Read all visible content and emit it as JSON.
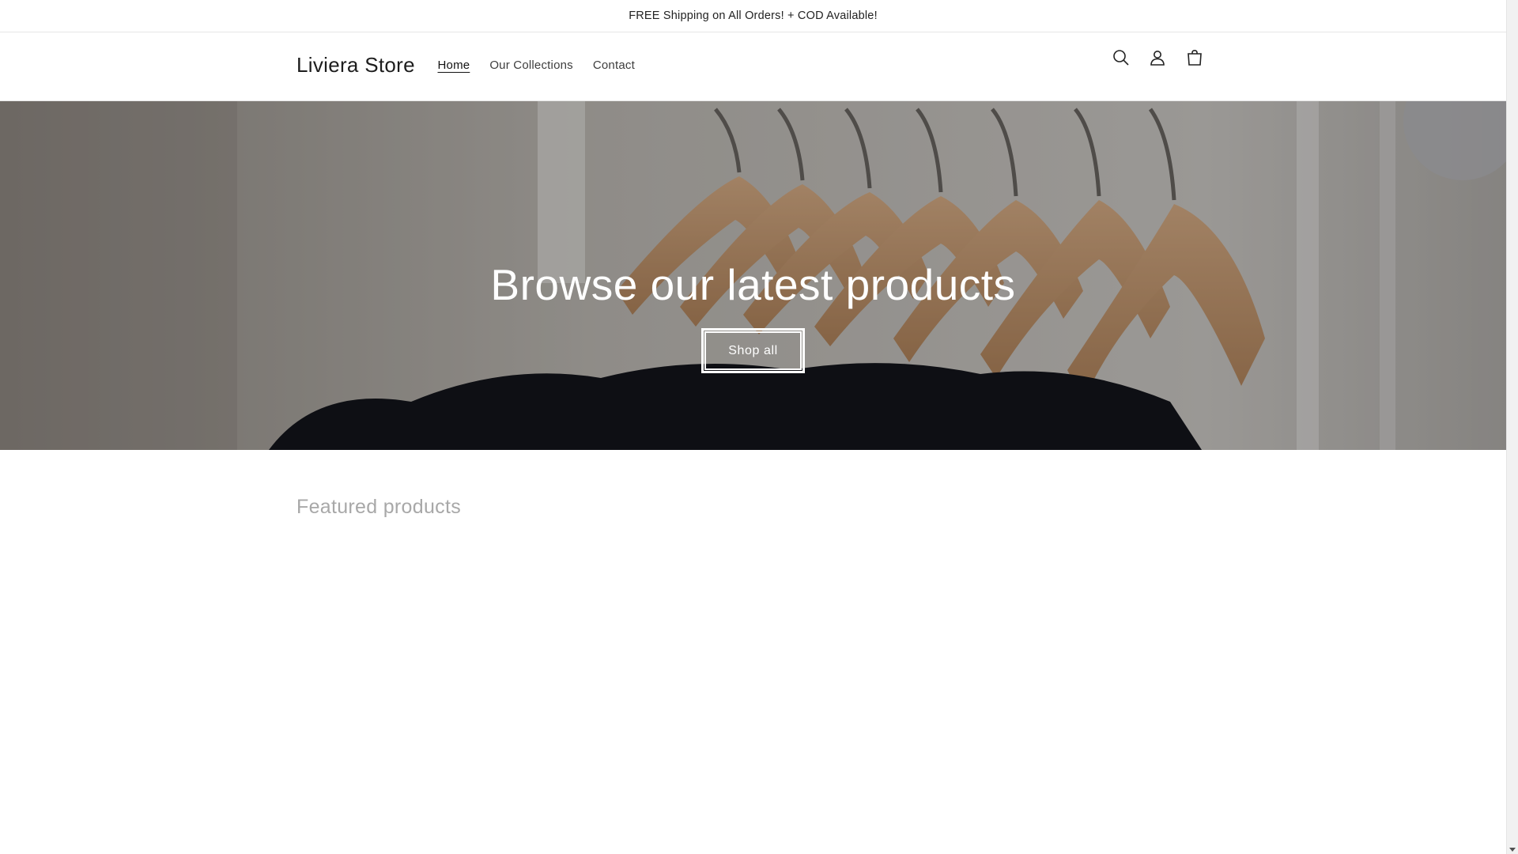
{
  "announcement": {
    "text": "FREE Shipping on All Orders! + COD Available!"
  },
  "header": {
    "logo": "Liviera Store",
    "nav": [
      {
        "label": "Home",
        "active": true
      },
      {
        "label": "Our Collections",
        "active": false
      },
      {
        "label": "Contact",
        "active": false
      }
    ],
    "icons": [
      "search-icon",
      "account-icon",
      "cart-icon"
    ]
  },
  "hero": {
    "title": "Browse our latest products",
    "button_label": "Shop all"
  },
  "featured": {
    "title": "Featured products"
  },
  "colors": {
    "text": "#121212",
    "muted_heading": "#a8a8a8",
    "hero_text": "#ffffff"
  }
}
